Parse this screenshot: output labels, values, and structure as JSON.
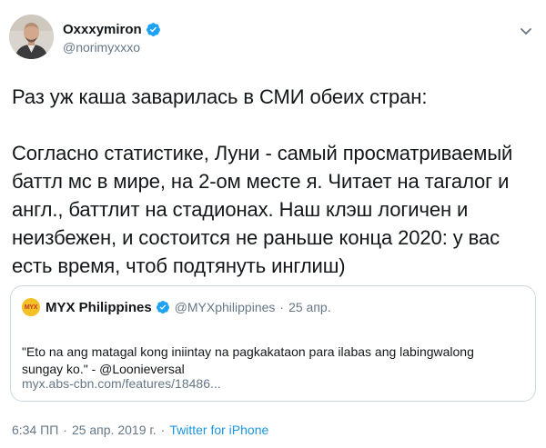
{
  "author": {
    "display_name": "Oxxxymiron",
    "handle": "@norimyxxxo",
    "verified": true
  },
  "tweet": {
    "paragraphs": [
      "Раз уж каша заварилась в СМИ обеих стран:",
      "Согласно статистике, Луни - самый просматриваемый\nбаттл мс в мире, на 2-ом месте я. Читает на тагалог и\nангл., баттлит на стадионах. Наш клэш логичен и\nнеизбежен, и состоится не раньше конца 2020: у вас\nесть время, чтоб подтянуть инглиш)"
    ]
  },
  "quoted_tweet": {
    "avatar_text": "MYX",
    "display_name": "MYX Philippines",
    "verified": true,
    "handle": "@MYXphilippines",
    "separator": "·",
    "date": "25 апр.",
    "text": "\"Eto na ang matagal kong iniintay na pagkakataon para ilabas ang labingwalong\nsungay ko.\" - @Loonieversal",
    "link": "myx.abs-cbn.com/features/18486..."
  },
  "meta": {
    "time": "6:34 ПП",
    "separator": "·",
    "date": "25 апр. 2019 г.",
    "source": "Twitter for iPhone"
  },
  "colors": {
    "text": "#14171a",
    "secondary": "#657786",
    "link": "#1b95e0",
    "verified": "#1da1f2",
    "border": "#ccd6dd"
  },
  "icons": [
    "verified-badge-icon",
    "caret-down-icon"
  ]
}
